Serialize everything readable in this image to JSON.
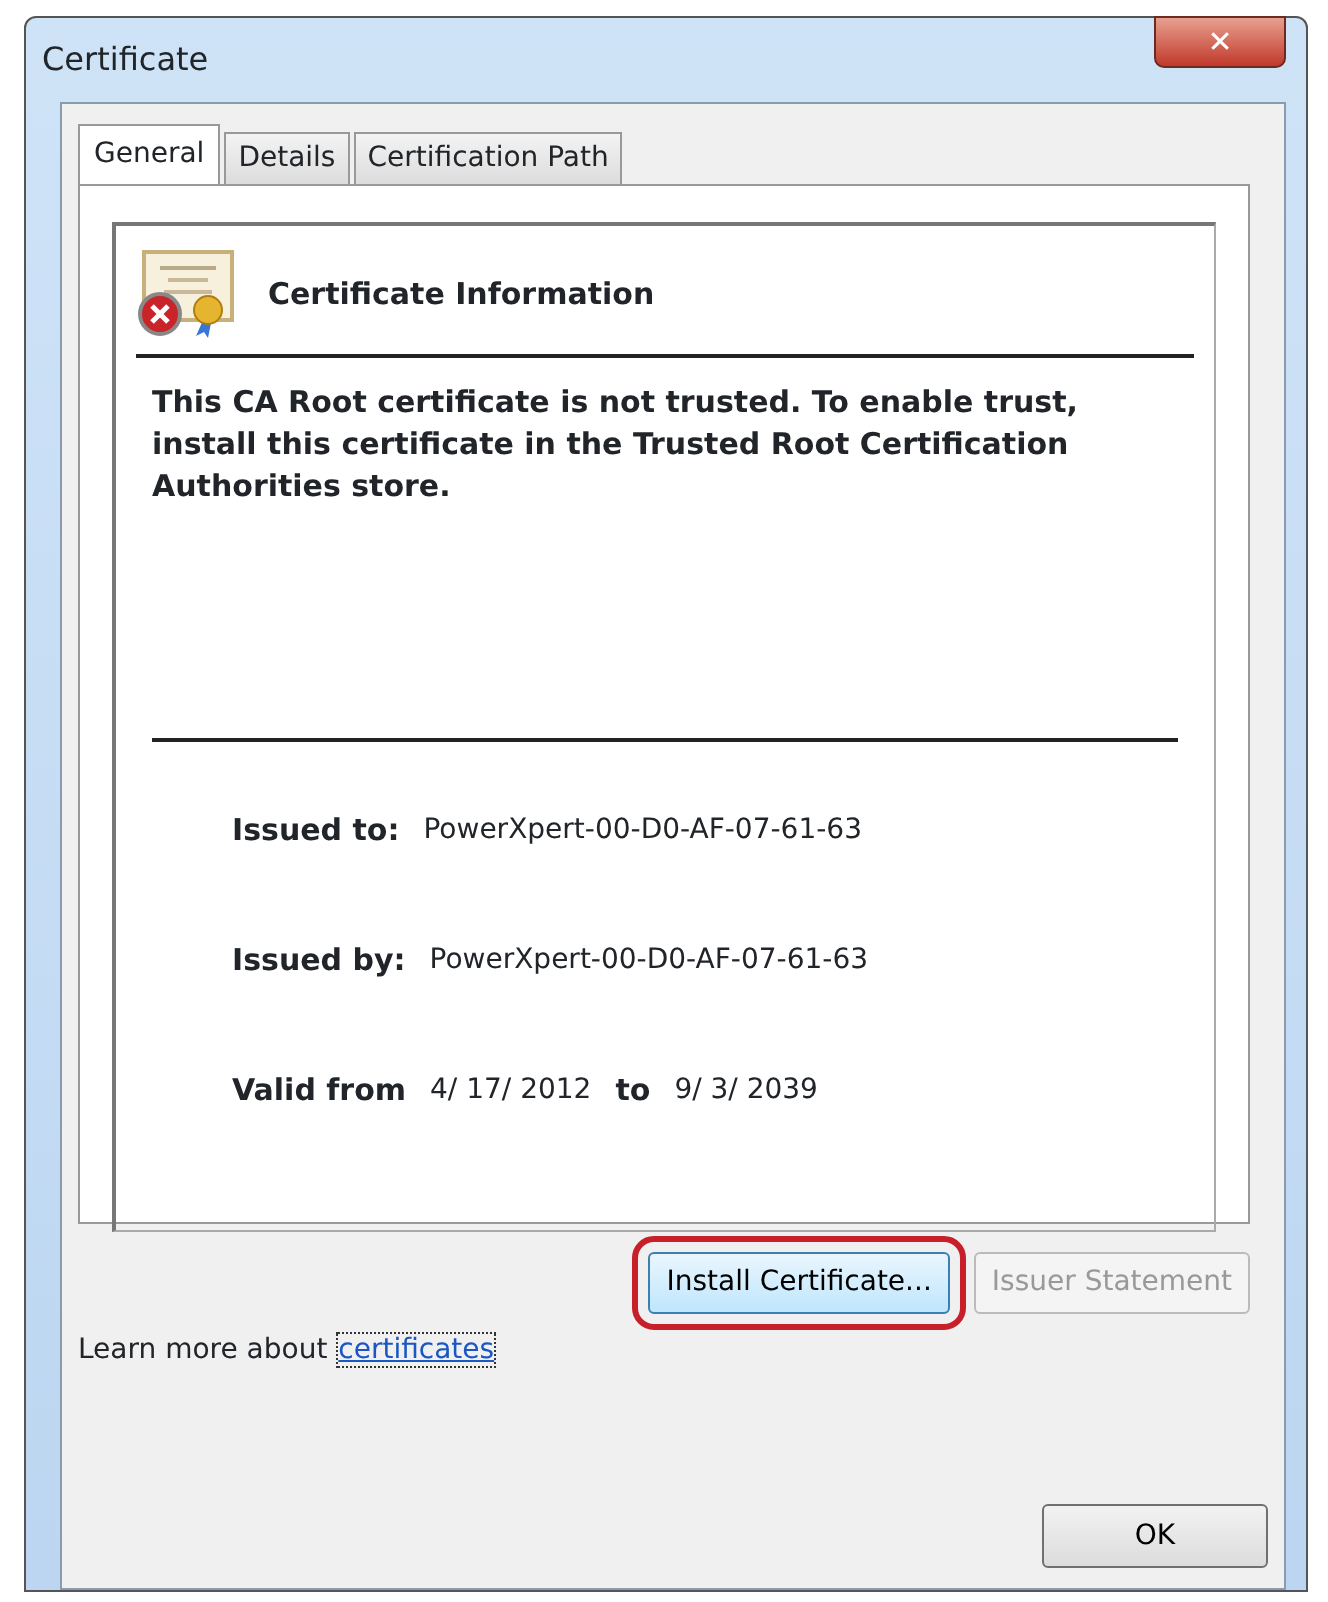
{
  "window": {
    "title": "Certificate",
    "close": "✕"
  },
  "tabs": [
    {
      "label": "General",
      "selected": true
    },
    {
      "label": "Details",
      "selected": false
    },
    {
      "label": "Certification Path",
      "selected": false
    }
  ],
  "info": {
    "heading": "Certificate Information",
    "message": "This CA Root certificate is not trusted. To enable trust, install this certificate in the Trusted Root Certification Authorities store."
  },
  "fields": [
    {
      "parts": [
        {
          "kind": "label",
          "text": "Issued to:"
        },
        {
          "kind": "value",
          "text": "PowerXpert-00-D0-AF-07-61-63"
        }
      ]
    },
    {
      "parts": [
        {
          "kind": "label",
          "text": "Issued by:"
        },
        {
          "kind": "value",
          "text": "PowerXpert-00-D0-AF-07-61-63"
        }
      ]
    },
    {
      "parts": [
        {
          "kind": "label",
          "text": "Valid from"
        },
        {
          "kind": "value",
          "text": "4/ 17/ 2012"
        },
        {
          "kind": "label",
          "text": "to"
        },
        {
          "kind": "value",
          "text": "9/ 3/ 2039"
        }
      ]
    }
  ],
  "buttons": [
    {
      "label": "Install Certificate...",
      "disabled": false,
      "highlighted": true
    },
    {
      "label": "Issuer Statement",
      "disabled": true,
      "highlighted": false
    }
  ],
  "learn_more": {
    "text": "Learn more about",
    "link": "certificates"
  },
  "ok": "OK"
}
